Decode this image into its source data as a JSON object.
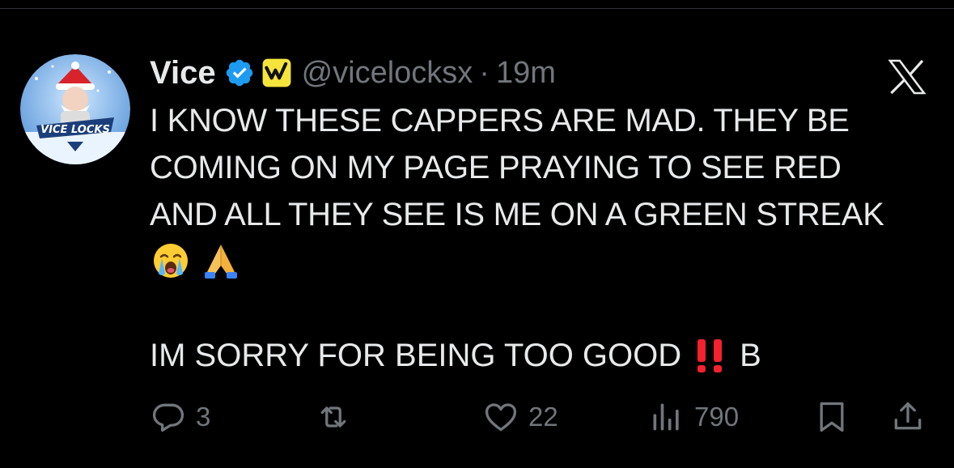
{
  "tweet": {
    "display_name": "Vice",
    "handle": "@vicelocksx",
    "separator": "·",
    "time": "19m",
    "avatar_text": "VICE LOCKS",
    "lines": [
      "I KNOW THESE CAPPERS ARE MAD. THEY BE",
      "COMING ON MY PAGE PRAYING TO SEE RED",
      "AND ALL THEY SEE IS ME ON A GREEN STREAK"
    ],
    "emojis": [
      "loudly-crying-face-emoji",
      "folded-hands-emoji"
    ],
    "last_line_before": "IM SORRY FOR BEING TOO GOOD",
    "last_line_after": "B"
  },
  "actions": {
    "replies": "3",
    "retweets": "",
    "likes": "22",
    "views": "790"
  },
  "colors": {
    "background": "#000000",
    "text": "#e7e9ea",
    "muted": "#71767b",
    "verified_blue": "#1d9bf0",
    "affiliate_yellow": "#f5e43b",
    "bang_red": "#f4212e"
  }
}
